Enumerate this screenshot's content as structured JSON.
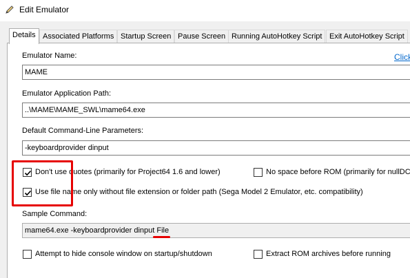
{
  "window": {
    "title": "Edit Emulator"
  },
  "tabs": [
    {
      "label": "Details"
    },
    {
      "label": "Associated Platforms"
    },
    {
      "label": "Startup Screen"
    },
    {
      "label": "Pause Screen"
    },
    {
      "label": "Running AutoHotkey Script"
    },
    {
      "label": "Exit AutoHotkey Script"
    }
  ],
  "details": {
    "emulator_name_label": "Emulator Name:",
    "emulator_name_value": "MAME",
    "link_text": "Click",
    "app_path_label": "Emulator Application Path:",
    "app_path_value": "..\\MAME\\MAME_SWL\\mame64.exe",
    "cmd_params_label": "Default Command-Line Parameters:",
    "cmd_params_value": "-keyboardprovider dinput",
    "dont_use_quotes_label": "Don't use quotes (primarily for Project64 1.6 and lower)",
    "dont_use_quotes_checked": true,
    "no_space_label": "No space before ROM (primarily for nullDC)",
    "no_space_checked": false,
    "use_filename_label": "Use file name only without file extension or folder path (Sega Model 2 Emulator, etc. compatibility)",
    "use_filename_checked": true,
    "sample_command_label": "Sample Command:",
    "sample_command_value": "mame64.exe -keyboardprovider dinput File",
    "hide_console_label": "Attempt to hide console window on startup/shutdown",
    "hide_console_checked": false,
    "extract_rom_label": "Extract ROM archives before running",
    "extract_rom_checked": false
  },
  "annotation_color": "#e60000"
}
